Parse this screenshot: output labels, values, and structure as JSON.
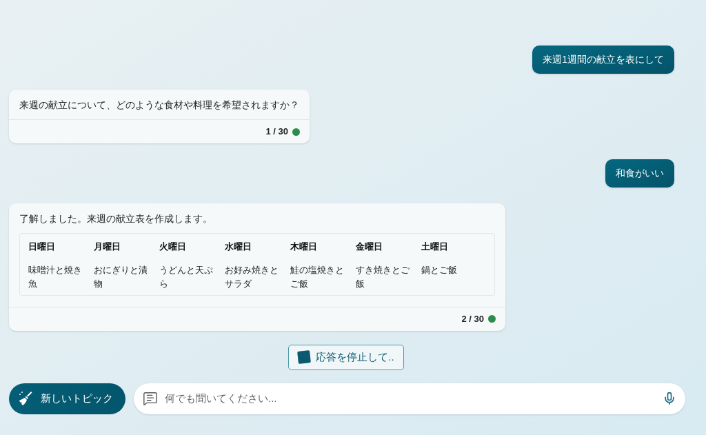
{
  "messages": [
    {
      "kind": "user",
      "text": "来週1週間の献立を表にして"
    },
    {
      "kind": "bot",
      "text": "来週の献立について、どのような食材や料理を希望されますか？",
      "counter": "1 / 30",
      "color": "#2e8b4e"
    },
    {
      "kind": "user",
      "text": "和食がいい"
    },
    {
      "kind": "bot",
      "text": "了解しました。来週の献立表を作成します。",
      "counter": "2 / 30",
      "color": "#2e8b4e",
      "table": {
        "columns": [
          "日曜日",
          "月曜日",
          "火曜日",
          "水曜日",
          "木曜日",
          "金曜日",
          "土曜日"
        ],
        "rows": [
          [
            "味噌汁と焼き魚",
            "おにぎりと漬物",
            "うどんと天ぷら",
            "お好み焼きとサラダ",
            "鮭の塩焼きとご飯",
            "すき焼きとご飯",
            "鍋とご飯"
          ]
        ]
      }
    }
  ],
  "stop_button": "応答を停止して..",
  "new_topic_button": "新しいトピック",
  "input": {
    "placeholder": "何でも聞いてください..."
  }
}
